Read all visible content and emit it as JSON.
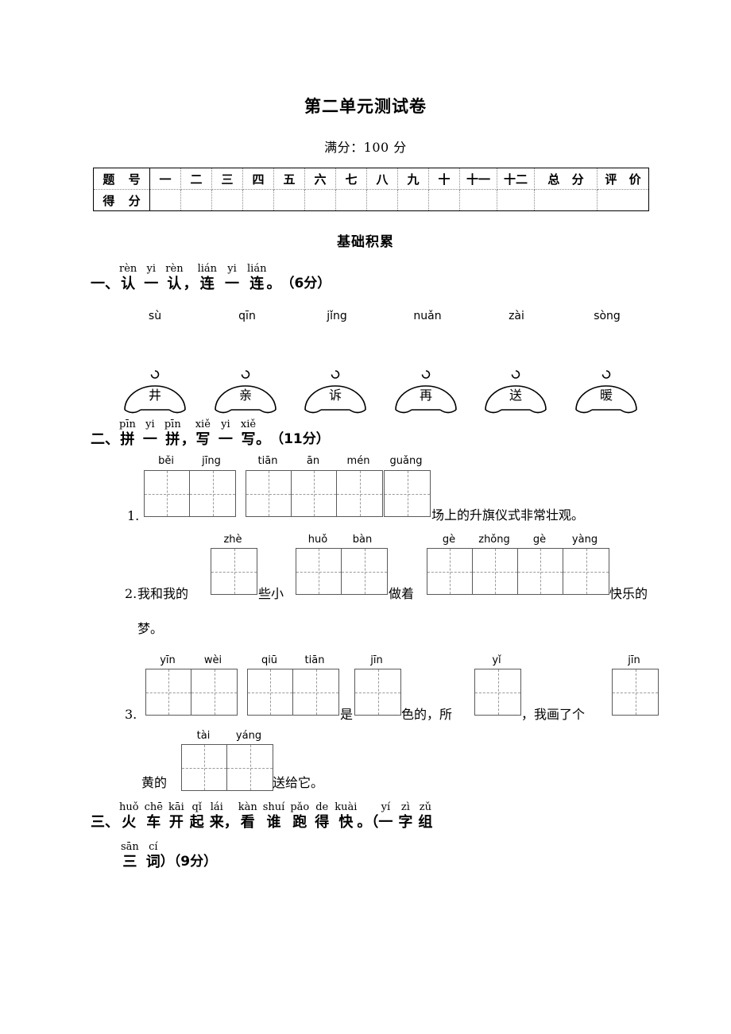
{
  "header": {
    "title": "第二单元测试卷",
    "subtitle": "满分：100 分"
  },
  "score_table": {
    "row_labels": [
      "题 号",
      "得 分"
    ],
    "columns": [
      "一",
      "二",
      "三",
      "四",
      "五",
      "六",
      "七",
      "八",
      "九",
      "十",
      "十一",
      "十二",
      "总 分",
      "评 价"
    ]
  },
  "part_one_banner": "基础积累",
  "questions": [
    {
      "index": "一、",
      "pinyin_words": [
        "rèn",
        "yi",
        "rèn",
        "lián",
        "yi",
        "lián"
      ],
      "hanzi_words": [
        "认",
        "一",
        "认",
        "连",
        "一",
        "连"
      ],
      "separators": [
        "",
        "",
        "，",
        "",
        "",
        "。"
      ],
      "points": "（6分）"
    },
    {
      "index": "二、",
      "pinyin_words": [
        "pīn",
        "yi",
        "pīn",
        "xiě",
        "yi",
        "xiě"
      ],
      "hanzi_words": [
        "拼",
        "一",
        "拼",
        "写",
        "一",
        "写"
      ],
      "separators": [
        "",
        "",
        "，",
        "",
        "",
        "。"
      ],
      "points": "（11分）"
    },
    {
      "index": "三、",
      "pinyin_words": [
        "huǒ",
        "chē",
        "kāi",
        "qǐ",
        "lái",
        "kàn",
        "shuí",
        "pǎo",
        "de",
        "kuài",
        "yí",
        "zì",
        "zǔ"
      ],
      "hanzi_words": [
        "火",
        "车",
        "开",
        "起",
        "来",
        "看",
        "谁",
        "跑",
        "得",
        "快",
        "一",
        "字",
        "组"
      ],
      "pinyin_words2": [
        "sān",
        "cí"
      ],
      "hanzi_words2": [
        "三",
        "词"
      ],
      "tail": "）（9分）",
      "points": "（9分）"
    }
  ],
  "q1": {
    "pinyin_row": [
      "sù",
      "qīn",
      "jǐng",
      "nuǎn",
      "zài",
      "sòng"
    ],
    "dome_chars": [
      "井",
      "亲",
      "诉",
      "再",
      "送",
      "暖"
    ]
  },
  "q2": {
    "line1": {
      "number": "1.",
      "groups": [
        {
          "pinyin": [
            "běi",
            "jīng"
          ]
        },
        {
          "pinyin": [
            "tiān",
            "ān",
            "mén"
          ]
        },
        {
          "pinyin": [
            "guǎng"
          ]
        }
      ],
      "tail": "场上的升旗仪式非常壮观。"
    },
    "line2": {
      "number": "2.",
      "lead": "我和我的",
      "mid1": "些小",
      "mid2": "做着",
      "tail": "快乐的",
      "tail2": "梦。",
      "groups": [
        {
          "pinyin": [
            "zhè"
          ]
        },
        {
          "pinyin": [
            "huǒ",
            "bàn"
          ]
        },
        {
          "pinyin": [
            "gè",
            "zhǒng",
            "gè",
            "yàng"
          ]
        }
      ]
    },
    "line3": {
      "number": "3.",
      "mid1": "是",
      "mid2": "色的，所",
      "mid3": "，我画了个",
      "lead4": "黄的",
      "tail4": "送给它。",
      "groups": [
        {
          "pinyin": [
            "yīn",
            "wèi"
          ]
        },
        {
          "pinyin": [
            "qiū",
            "tiān"
          ]
        },
        {
          "pinyin": [
            "jīn"
          ]
        },
        {
          "pinyin": [
            "yǐ"
          ]
        },
        {
          "pinyin": [
            "jīn"
          ]
        },
        {
          "pinyin": [
            "tài",
            "yáng"
          ]
        }
      ]
    }
  }
}
